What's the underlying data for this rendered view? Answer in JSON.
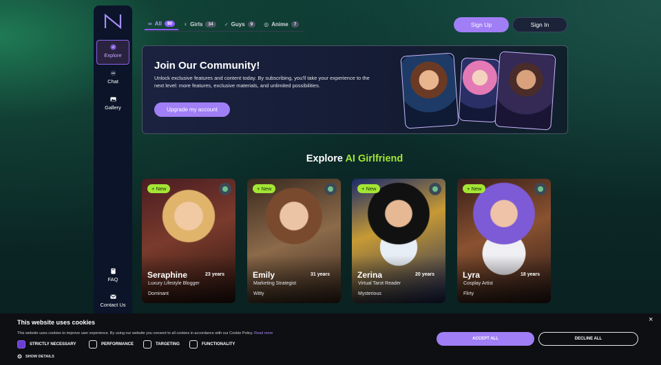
{
  "nav": {
    "items": [
      {
        "label": "Explore",
        "icon": "compass-icon"
      },
      {
        "label": "Chat",
        "icon": "chat-dots-icon"
      },
      {
        "label": "Gallery",
        "icon": "image-icon"
      },
      {
        "label": "FAQ",
        "icon": "book-icon"
      },
      {
        "label": "Contact Us",
        "icon": "envelope-icon"
      }
    ]
  },
  "tabs": [
    {
      "label": "All",
      "count": "80",
      "icon": "∞"
    },
    {
      "label": "Girls",
      "count": "34",
      "icon": "♀"
    },
    {
      "label": "Guys",
      "count": "9",
      "icon": "♂"
    },
    {
      "label": "Anime",
      "count": "7",
      "icon": "◎"
    }
  ],
  "header": {
    "signup": "Sign Up",
    "signin": "Sign In"
  },
  "banner": {
    "title": "Join Our Community!",
    "text": "Unlock exclusive features and content today. By subscribing, you'll take your experience to the next level: more features, exclusive materials, and unlimited possibilities.",
    "button": "Upgrade my account"
  },
  "section": {
    "title_prefix": "Explore ",
    "title_accent": "AI Girlfriend"
  },
  "cards": [
    {
      "badge": "+ New",
      "name": "Seraphine",
      "age": "23 years",
      "role": "Luxury Lifestyle Blogger",
      "trait": "Dominant"
    },
    {
      "badge": "+ New",
      "name": "Emily",
      "age": "31 years",
      "role": "Marketing Strategist",
      "trait": "Witty"
    },
    {
      "badge": "+ New",
      "name": "Zerina",
      "age": "20 years",
      "role": "Virtual Tarot Reader",
      "trait": "Mysterious"
    },
    {
      "badge": "+ New",
      "name": "Lyra",
      "age": "18 years",
      "role": "Cosplay Artist",
      "trait": "Flirty"
    }
  ],
  "cookie": {
    "title": "This website uses cookies",
    "text": "This website uses cookies to improve user experience. By using our website you consent to all cookies in accordance with our Cookie Policy.",
    "link": "Read more",
    "options": [
      "STRICTLY NECESSARY",
      "PERFORMANCE",
      "TARGETING",
      "FUNCTIONALITY"
    ],
    "show_details": "SHOW DETAILS",
    "accept": "ACCEPT ALL",
    "decline": "DECLINE ALL",
    "close": "×"
  },
  "colors": {
    "accent": "#a07ef5",
    "highlight": "#a3e635",
    "new_badge": "#a3e635"
  }
}
